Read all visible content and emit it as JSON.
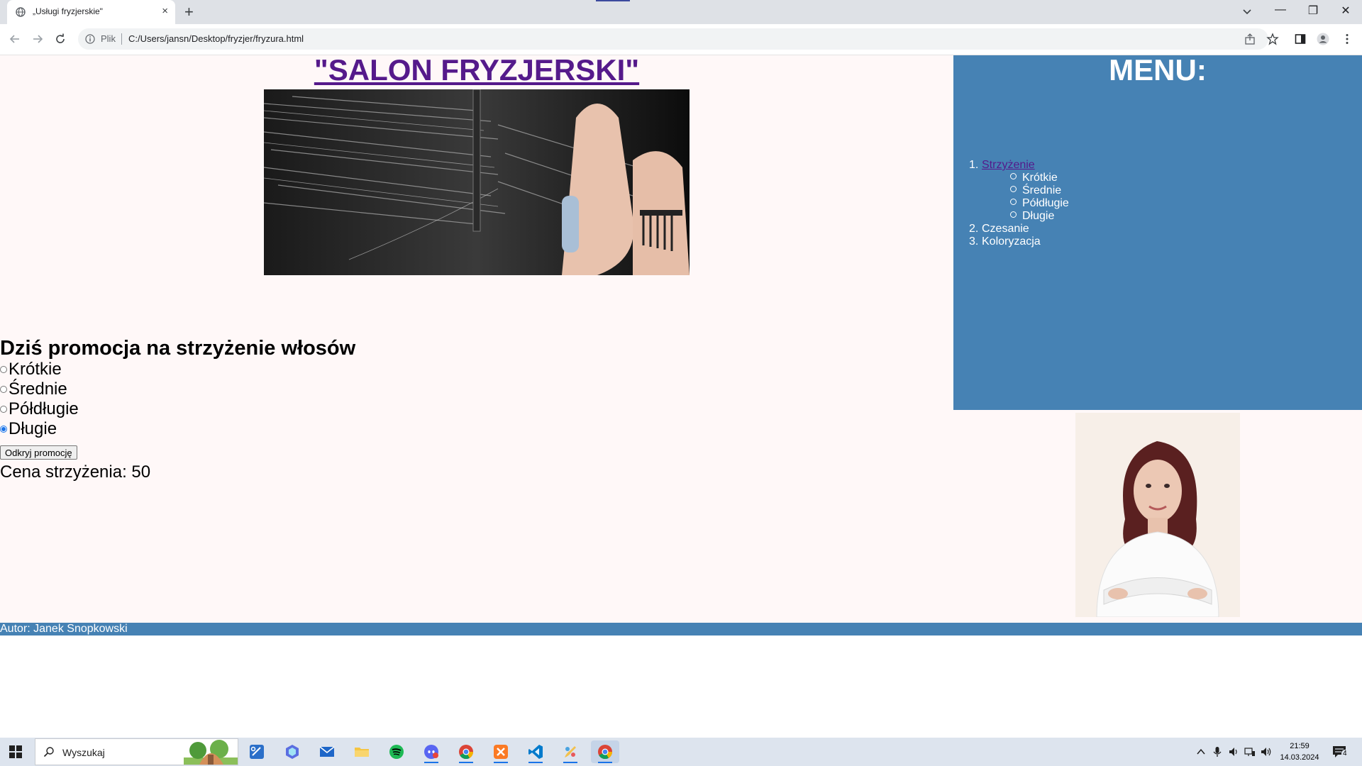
{
  "browser": {
    "tab_title": "„Usługi fryzjerskie\"",
    "tab_close": "×",
    "new_tab": "+",
    "window_buttons": [
      "—",
      "❐",
      "✕"
    ],
    "omnibox_scheme": "Plik",
    "url": "C:/Users/jansn/Desktop/fryzjer/fryzura.html"
  },
  "page": {
    "title": "\"SALON FRYZJERSKI\"",
    "hero_image": "hair-cutting-photo",
    "promo_heading": "Dziś promocja na strzyżenie włosów",
    "options": [
      {
        "label": "Krótkie",
        "checked": false
      },
      {
        "label": "Średnie",
        "checked": false
      },
      {
        "label": "Półdługie",
        "checked": false
      },
      {
        "label": "Długie",
        "checked": true
      }
    ],
    "promo_button": "Odkryj promocję",
    "price_line": "Cena strzyżenia: 50",
    "menu": {
      "title": "MENU:",
      "items": [
        {
          "num": "1.",
          "label": "Strzyżenie",
          "link": true
        },
        {
          "num": "2.",
          "label": "Czesanie",
          "link": false
        },
        {
          "num": "3.",
          "label": "Koloryzacja",
          "link": false
        }
      ],
      "subitems": [
        "Krótkie",
        "Średnie",
        "Półdługie",
        "Długie"
      ]
    },
    "portrait_image": "hairdresser-portrait",
    "footer": "Autor: Janek Snopkowski"
  },
  "taskbar": {
    "search_placeholder": "Wyszukaj",
    "time": "21:59",
    "date": "14.03.2024",
    "notification_count": "4",
    "apps": [
      "snipping-tool",
      "copilot",
      "mail",
      "file-explorer",
      "spotify",
      "discord",
      "chrome",
      "xampp",
      "vscode",
      "paint",
      "chrome-active"
    ]
  },
  "colors": {
    "accent_blue": "#4682b4",
    "link_purple": "#551a8b",
    "page_bg": "#fff8f8"
  }
}
